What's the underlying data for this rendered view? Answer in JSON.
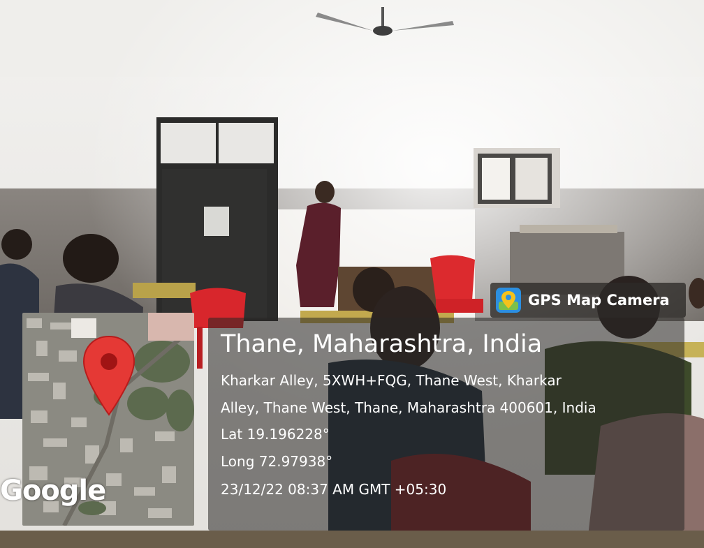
{
  "overlay": {
    "app_name": "GPS Map Camera",
    "location_title": "Thane, Maharashtra, India",
    "address_line_1": "Kharkar Alley, 5XWH+FQG, Thane West, Kharkar",
    "address_line_2": "Alley, Thane West, Thane, Maharashtra 400601, India",
    "latitude": "Lat 19.196228°",
    "longitude": "Long 72.97938°",
    "datetime": "23/12/22 08:37 AM GMT +05:30",
    "map_brand": "Google",
    "app_icon": "gps-map-camera-app-icon",
    "pin_icon": "map-pin-icon",
    "pin_color": "#e53935"
  }
}
